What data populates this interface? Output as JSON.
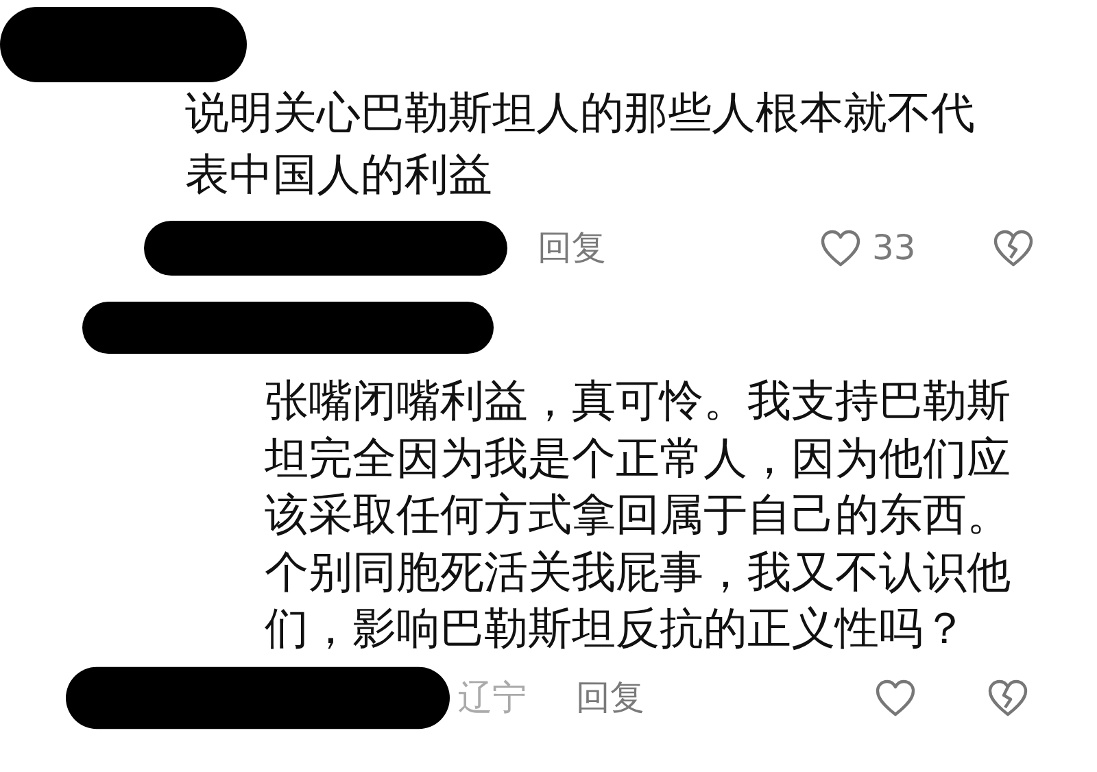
{
  "comments": [
    {
      "author": {
        "redacted": true
      },
      "text": "说明关心巴勒斯坦人的那些人根本就不代表中国人的利益",
      "meta": {
        "redacted": true,
        "reply": "回复",
        "likes": "33"
      }
    },
    {
      "author": {
        "redacted": true
      },
      "text": "张嘴闭嘴利益，真可怜。我支持巴勒斯坦完全因为我是个正常人，因为他们应该采取任何方式拿回属于自己的东西。个别同胞死活关我屁事，我又不认识他们，影响巴勒斯坦反抗的正义性吗？",
      "meta": {
        "redacted": true,
        "location": "辽宁",
        "reply": "回复"
      }
    }
  ]
}
